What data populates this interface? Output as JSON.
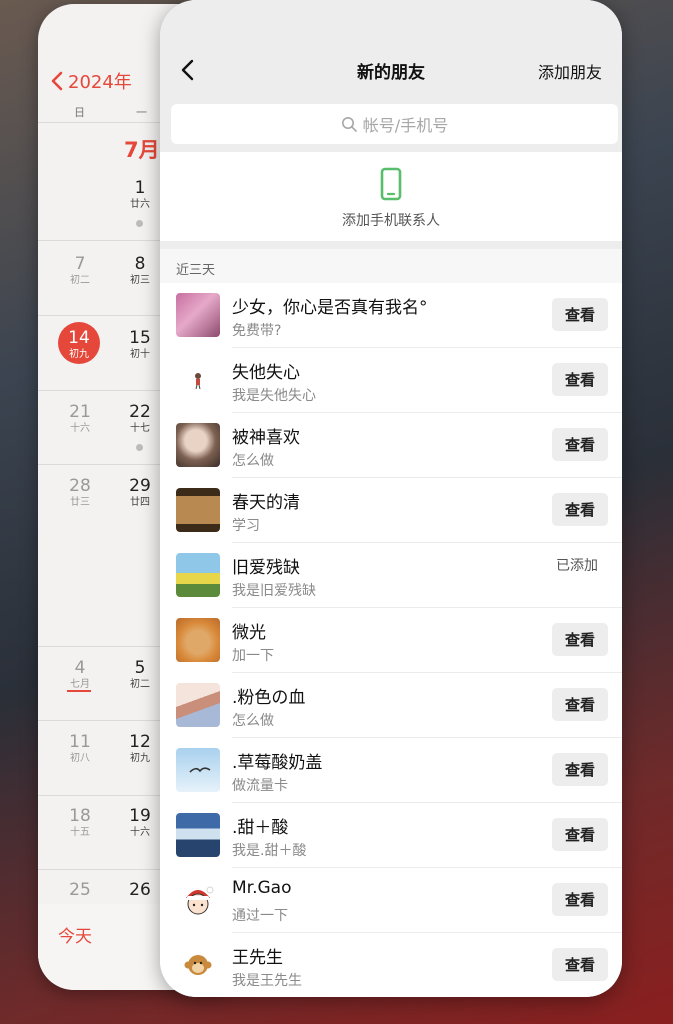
{
  "calendar": {
    "year_label": "2024年",
    "weekday_labels": [
      "日",
      "一"
    ],
    "month_label": "7月",
    "today_label": "今天",
    "days": [
      {
        "num": "1",
        "lunar": "廿六"
      },
      {
        "num": "7",
        "lunar": "初二"
      },
      {
        "num": "8",
        "lunar": "初三"
      },
      {
        "num": "14",
        "lunar": "初九"
      },
      {
        "num": "15",
        "lunar": "初十"
      },
      {
        "num": "21",
        "lunar": "十六"
      },
      {
        "num": "22",
        "lunar": "十七"
      },
      {
        "num": "28",
        "lunar": "廿三"
      },
      {
        "num": "29",
        "lunar": "廿四"
      },
      {
        "num": "4",
        "lunar": "七月"
      },
      {
        "num": "5",
        "lunar": "初二"
      },
      {
        "num": "11",
        "lunar": "初八"
      },
      {
        "num": "12",
        "lunar": "初九"
      },
      {
        "num": "18",
        "lunar": "十五"
      },
      {
        "num": "19",
        "lunar": "十六"
      },
      {
        "num": "25",
        "lunar": ""
      },
      {
        "num": "26",
        "lunar": ""
      }
    ],
    "accent_color": "#e5483a"
  },
  "header": {
    "title": "新的朋友",
    "add_label": "添加朋友"
  },
  "search": {
    "placeholder": "帐号/手机号"
  },
  "phone_contacts": {
    "label": "添加手机联系人",
    "icon_color": "#58be6a"
  },
  "section": {
    "title": "近三天"
  },
  "requests": [
    {
      "name": "少女，你心是否真有我名°",
      "message": "免费带?",
      "action": "查看"
    },
    {
      "name": "失他失心",
      "message": "我是失他失心",
      "action": "查看"
    },
    {
      "name": "被神喜欢",
      "message": "怎么做",
      "action": "查看"
    },
    {
      "name": "春天的清",
      "message": "学习",
      "action": "查看"
    },
    {
      "name": "旧爱残缺",
      "message": "我是旧爱残缺",
      "action": "已添加"
    },
    {
      "name": "微光",
      "message": "加一下",
      "action": "查看"
    },
    {
      "name": ".粉色の血",
      "message": "怎么做",
      "action": "查看"
    },
    {
      "name": ".草莓酸奶盖",
      "message": "做流量卡",
      "action": "查看"
    },
    {
      "name": ".甜＋酸",
      "message": "我是.甜＋酸",
      "action": "查看"
    },
    {
      "name": "Mr.Gao",
      "message": "通过一下",
      "action": "查看"
    },
    {
      "name": "王先生",
      "message": "我是王先生",
      "action": "查看"
    }
  ]
}
